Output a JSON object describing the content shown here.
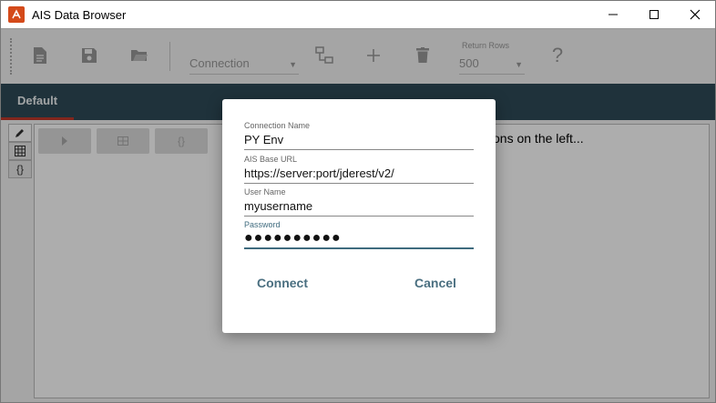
{
  "window": {
    "title": "AIS Data Browser"
  },
  "toolbar": {
    "connection_placeholder": "Connection",
    "return_rows_label": "Return Rows",
    "return_rows_value": "500",
    "help_glyph": "?"
  },
  "tabs": [
    {
      "label": "Default"
    }
  ],
  "content": {
    "hint_text": "ons on the left..."
  },
  "side_tools": {
    "json_glyph": "{}"
  },
  "dialog": {
    "connection_name_label": "Connection Name",
    "connection_name_value": "PY Env",
    "base_url_label": "AIS Base URL",
    "base_url_value": "https://server:port/jderest/v2/",
    "user_name_label": "User Name",
    "user_name_value": "myusername",
    "password_label": "Password",
    "password_value": "●●●●●●●●●●",
    "connect_label": "Connect",
    "cancel_label": "Cancel"
  },
  "colors": {
    "tabbar": "#2f4a57",
    "accent": "#3f6b7e",
    "tab_underline": "#c0392b",
    "app_icon": "#d44a1a"
  }
}
